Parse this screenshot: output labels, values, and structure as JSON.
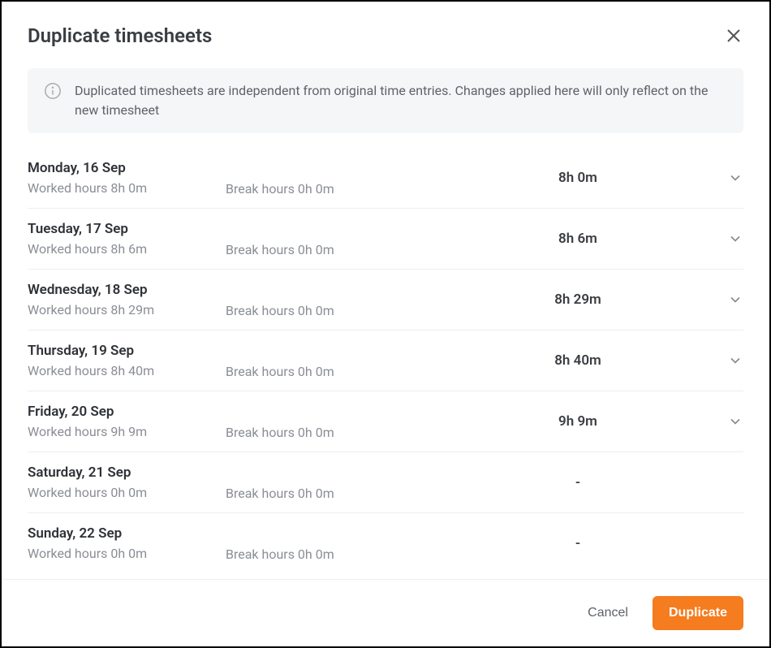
{
  "header": {
    "title": "Duplicate timesheets"
  },
  "info": {
    "text": "Duplicated timesheets are independent from original time entries. Changes applied here will only reflect on the new timesheet"
  },
  "labels": {
    "worked_prefix": "Worked hours ",
    "break_prefix": "Break hours "
  },
  "days": [
    {
      "name": "Monday, 16 Sep",
      "worked": "8h 0m",
      "break": "0h 0m",
      "total": "8h 0m",
      "expandable": true
    },
    {
      "name": "Tuesday, 17 Sep",
      "worked": "8h 6m",
      "break": "0h 0m",
      "total": "8h 6m",
      "expandable": true
    },
    {
      "name": "Wednesday, 18 Sep",
      "worked": "8h 29m",
      "break": "0h 0m",
      "total": "8h 29m",
      "expandable": true
    },
    {
      "name": "Thursday, 19 Sep",
      "worked": "8h 40m",
      "break": "0h 0m",
      "total": "8h 40m",
      "expandable": true
    },
    {
      "name": "Friday, 20 Sep",
      "worked": "9h 9m",
      "break": "0h 0m",
      "total": "9h 9m",
      "expandable": true
    },
    {
      "name": "Saturday, 21 Sep",
      "worked": "0h 0m",
      "break": "0h 0m",
      "total": "-",
      "expandable": false
    },
    {
      "name": "Sunday, 22 Sep",
      "worked": "0h 0m",
      "break": "0h 0m",
      "total": "-",
      "expandable": false
    }
  ],
  "footer": {
    "cancel": "Cancel",
    "duplicate": "Duplicate"
  }
}
